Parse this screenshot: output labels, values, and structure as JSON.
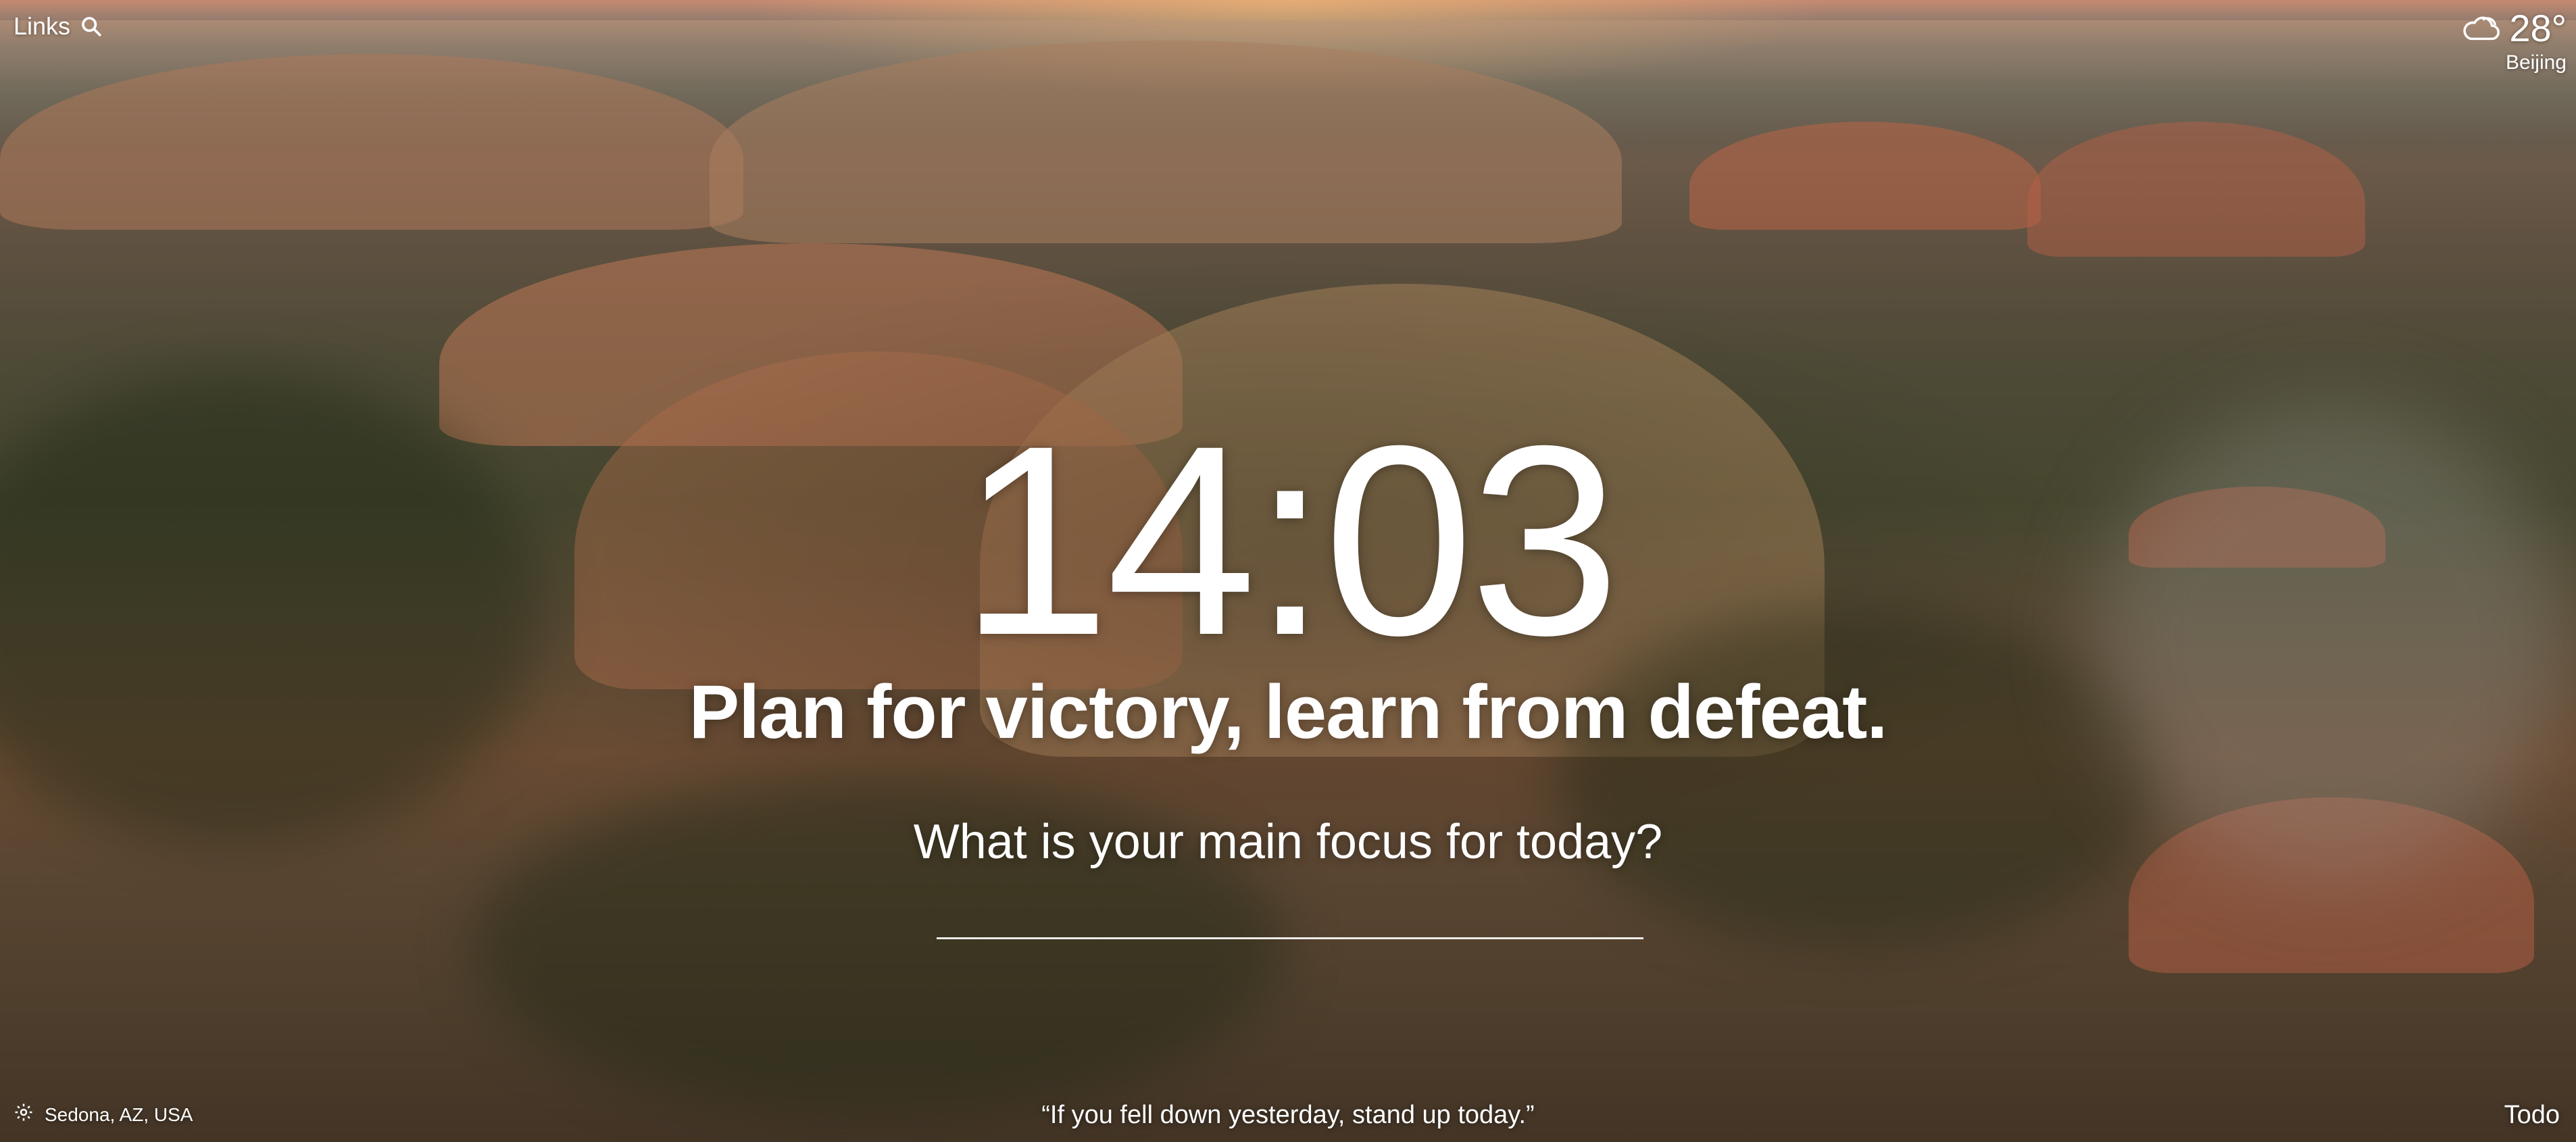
{
  "top_left": {
    "links_label": "Links",
    "search_icon": "search-icon"
  },
  "weather": {
    "icon": "cloud-icon",
    "temperature": "28°",
    "location": "Beijing"
  },
  "center": {
    "time": "14:03",
    "mantra": "Plan for victory, learn from defeat."
  },
  "focus": {
    "question": "What is your main focus for today?",
    "input_value": ""
  },
  "bottom": {
    "settings_icon": "gear-icon",
    "photo_location": "Sedona, AZ, USA",
    "quote": "“If you fell down yesterday, stand up today.”",
    "todo_label": "Todo"
  },
  "colors": {
    "text": "#ffffff",
    "background_primary": "#5a4632",
    "background_accent": "#c58a72"
  }
}
